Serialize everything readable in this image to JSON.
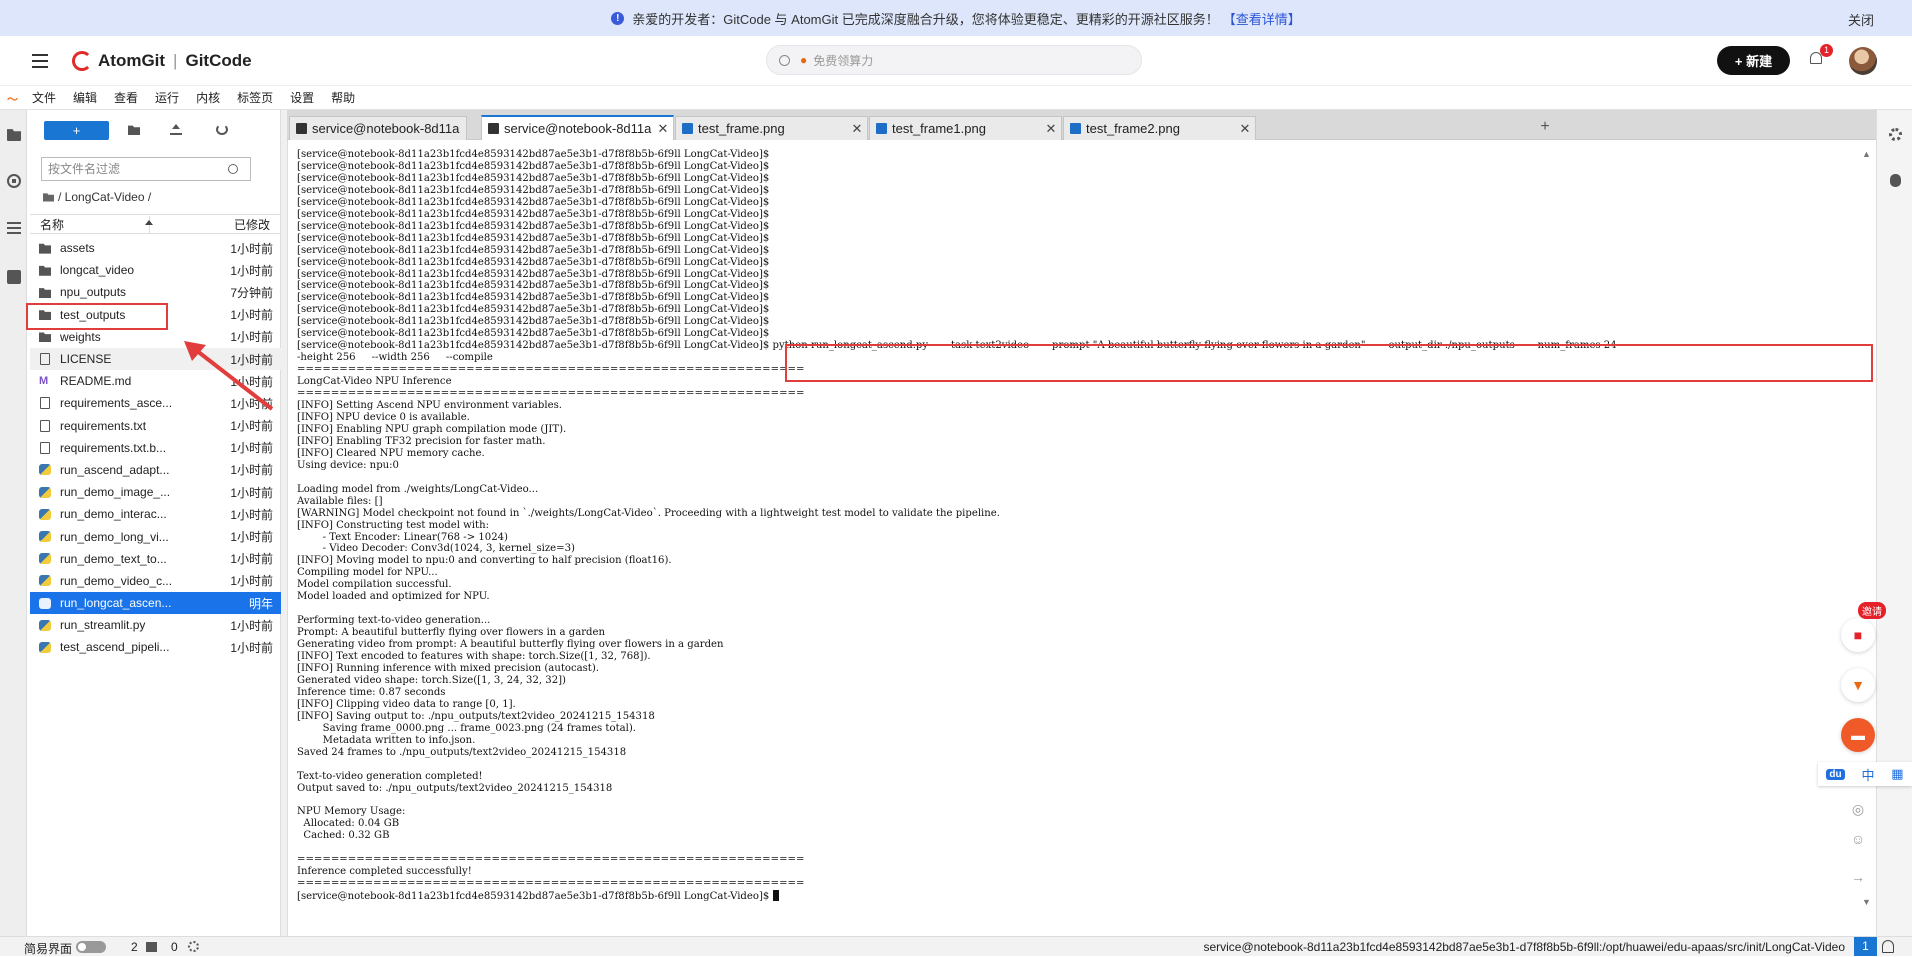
{
  "announcement": {
    "text": "亲爱的开发者：GitCode 与 AtomGit 已完成深度融合升级，您将体验更稳定、更精彩的开源社区服务！",
    "link": "【查看详情】",
    "close": "关闭"
  },
  "header": {
    "brand1": "AtomGit",
    "brand_sep": "|",
    "brand2": "GitCode",
    "search_placeholder": "免费领算力",
    "new_button": "+ 新建",
    "notification_count": "1"
  },
  "menu": [
    "文件",
    "编辑",
    "查看",
    "运行",
    "内核",
    "标签页",
    "设置",
    "帮助"
  ],
  "file_browser": {
    "new_label": "+",
    "filter_placeholder": "按文件名过滤",
    "breadcrumb": "/ LongCat-Video /",
    "col_name": "名称",
    "col_modified": "已修改",
    "files": [
      {
        "name": "assets",
        "type": "folder",
        "time": "1小时前"
      },
      {
        "name": "longcat_video",
        "type": "folder",
        "time": "1小时前"
      },
      {
        "name": "npu_outputs",
        "type": "folder",
        "time": "7分钟前"
      },
      {
        "name": "test_outputs",
        "type": "folder",
        "time": "1小时前"
      },
      {
        "name": "weights",
        "type": "folder",
        "time": "1小时前"
      },
      {
        "name": "LICENSE",
        "type": "file",
        "time": "1小时前"
      },
      {
        "name": "README.md",
        "type": "md",
        "time": "1小时前"
      },
      {
        "name": "requirements_asce...",
        "type": "file",
        "time": "1小时前"
      },
      {
        "name": "requirements.txt",
        "type": "file",
        "time": "1小时前"
      },
      {
        "name": "requirements.txt.b...",
        "type": "file",
        "time": "1小时前"
      },
      {
        "name": "run_ascend_adapt...",
        "type": "py",
        "time": "1小时前"
      },
      {
        "name": "run_demo_image_...",
        "type": "py",
        "time": "1小时前"
      },
      {
        "name": "run_demo_interac...",
        "type": "py",
        "time": "1小时前"
      },
      {
        "name": "run_demo_long_vi...",
        "type": "py",
        "time": "1小时前"
      },
      {
        "name": "run_demo_text_to...",
        "type": "py",
        "time": "1小时前"
      },
      {
        "name": "run_demo_video_c...",
        "type": "py",
        "time": "1小时前"
      },
      {
        "name": "run_longcat_ascen...",
        "type": "py",
        "time": "明年",
        "selected": true
      },
      {
        "name": "run_streamlit.py",
        "type": "py",
        "time": "1小时前"
      },
      {
        "name": "test_ascend_pipeli...",
        "type": "py",
        "time": "1小时前"
      }
    ]
  },
  "tabs": [
    {
      "label": "service@notebook-8d11a",
      "icon": "terminal-icon"
    },
    {
      "label": "service@notebook-8d11a",
      "icon": "terminal-icon",
      "active": true
    },
    {
      "label": "test_frame.png",
      "icon": "image-icon"
    },
    {
      "label": "test_frame1.png",
      "icon": "image-icon"
    },
    {
      "label": "test_frame2.png",
      "icon": "image-icon"
    }
  ],
  "terminal": {
    "prompt": "[service@notebook-8d11a23b1fcd4e8593142bd87ae5e3b1-d7f8f8b5b-6f9ll LongCat-Video]$",
    "repeat_prompts": 16,
    "command": " python run_longcat_ascend.py     --task text2video     --prompt \"A beautiful butterfly flying over flowers in a garden\"     --output_dir ./npu_outputs     --num_frames 24     -",
    "command_cont": "-height 256     --width 256     --compile",
    "output_lines": [
      "============================================================",
      "LongCat-Video NPU Inference",
      "============================================================",
      "[INFO] Setting Ascend NPU environment variables.",
      "[INFO] NPU device 0 is available.",
      "[INFO] Enabling NPU graph compilation mode (JIT).",
      "[INFO] Enabling TF32 precision for faster math.",
      "[INFO] Cleared NPU memory cache.",
      "Using device: npu:0",
      "",
      "Loading model from ./weights/LongCat-Video...",
      "Available files: []",
      "[WARNING] Model checkpoint not found in `./weights/LongCat-Video`. Proceeding with a lightweight test model to validate the pipeline.",
      "[INFO] Constructing test model with:",
      "        - Text Encoder: Linear(768 -> 1024)",
      "        - Video Decoder: Conv3d(1024, 3, kernel_size=3)",
      "[INFO] Moving model to npu:0 and converting to half precision (float16).",
      "Compiling model for NPU...",
      "Model compilation successful.",
      "Model loaded and optimized for NPU.",
      "",
      "Performing text-to-video generation...",
      "Prompt: A beautiful butterfly flying over flowers in a garden",
      "Generating video from prompt: A beautiful butterfly flying over flowers in a garden",
      "[INFO] Text encoded to features with shape: torch.Size([1, 32, 768]).",
      "[INFO] Running inference with mixed precision (autocast).",
      "Generated video shape: torch.Size([1, 3, 24, 32, 32])",
      "Inference time: 0.87 seconds",
      "[INFO] Clipping video data to range [0, 1].",
      "[INFO] Saving output to: ./npu_outputs/text2video_20241215_154318",
      "        Saving frame_0000.png ... frame_0023.png (24 frames total).",
      "        Metadata written to info.json.",
      "Saved 24 frames to ./npu_outputs/text2video_20241215_154318",
      "",
      "Text-to-video generation completed!",
      "Output saved to: ./npu_outputs/text2video_20241215_154318",
      "",
      "NPU Memory Usage:",
      "  Allocated: 0.04 GB",
      "  Cached: 0.32 GB",
      "",
      "============================================================",
      "Inference completed successfully!",
      "============================================================"
    ]
  },
  "float": {
    "invite": "邀请",
    "ime_cn": "中"
  },
  "status": {
    "simple_mode": "简易界面",
    "terminals": "2",
    "kernels": "0",
    "path": "service@notebook-8d11a23b1fcd4e8593142bd87ae5e3b1-d7f8f8b5b-6f9ll:/opt/huawei/edu-apaas/src/init/LongCat-Video",
    "page": "1"
  },
  "colors": {
    "accent": "#1976d2",
    "annotation": "#e23d3d",
    "brand_red": "#e02b2b"
  }
}
